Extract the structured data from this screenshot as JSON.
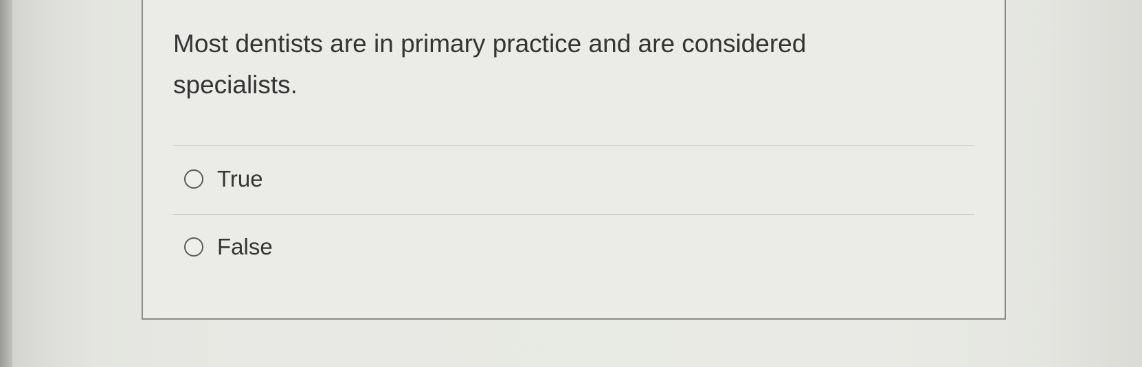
{
  "question": {
    "text": "Most dentists are in primary practice and are considered specialists."
  },
  "options": [
    {
      "label": "True",
      "selected": false
    },
    {
      "label": "False",
      "selected": false
    }
  ],
  "colors": {
    "border": "#8a8b88",
    "divider": "#c7c8c3",
    "text": "#333434",
    "radio_stroke": "#5a5b5a"
  }
}
